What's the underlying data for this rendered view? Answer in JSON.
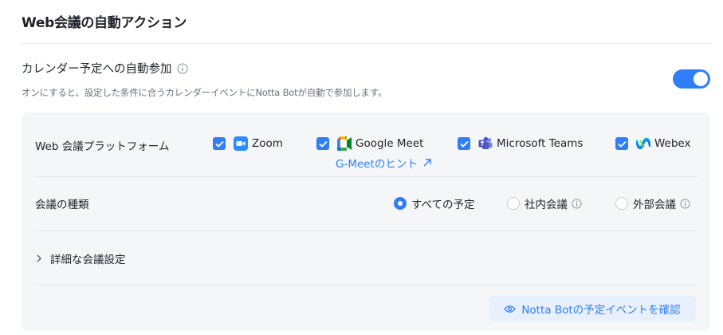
{
  "section": {
    "title": "Web会議の自動アクション"
  },
  "auto_join": {
    "title": "カレンダー予定への自動参加",
    "description": "オンにすると、設定した条件に合うカレンダーイベントにNotta Botが自動で参加します。",
    "enabled": true,
    "accent_color": "#2f7ef5"
  },
  "platforms": {
    "label": "Web 会議プラットフォーム",
    "items": [
      {
        "name": "Zoom",
        "checked": true,
        "icon": "zoom-icon"
      },
      {
        "name": "Google Meet",
        "checked": true,
        "icon": "google-meet-icon"
      },
      {
        "name": "Microsoft Teams",
        "checked": true,
        "icon": "microsoft-teams-icon"
      },
      {
        "name": "Webex",
        "checked": true,
        "icon": "webex-icon"
      }
    ],
    "hint_link": "G-Meetのヒント"
  },
  "meeting_type": {
    "label": "会議の種類",
    "options": [
      {
        "label": "すべての予定",
        "selected": true
      },
      {
        "label": "社内会議",
        "selected": false
      },
      {
        "label": "外部会議",
        "selected": false
      }
    ]
  },
  "details": {
    "label": "詳細な会議設定"
  },
  "confirm_button": {
    "label": "Notta Botの予定イベントを確認"
  }
}
